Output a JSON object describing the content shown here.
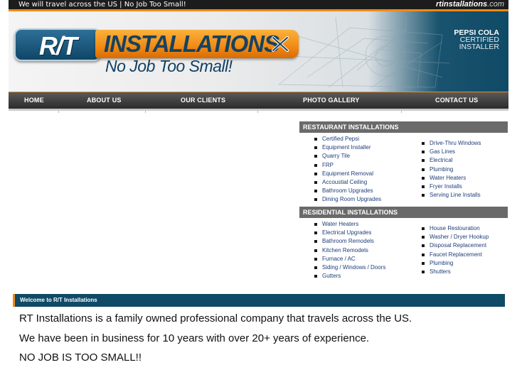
{
  "topbar": {
    "tagline": "We will travel across the US | No Job Too Small!",
    "domain_bold": "rtinstallations",
    "domain_suffix": ".com"
  },
  "header": {
    "logo_rt": "R/T",
    "logo_installations": "INSTALLATIONS",
    "slogan": "No Job Too Small!",
    "badge": [
      "PEPSI COLA",
      "CERTIFIED",
      "INSTALLER"
    ]
  },
  "nav": {
    "items": [
      "HOME",
      "ABOUT US",
      "OUR CLIENTS",
      "PHOTO GALLERY",
      "CONTACT US"
    ]
  },
  "restaurant": {
    "title": "RESTAURANT INSTALLATIONS",
    "col1": [
      "Certified Pepsi",
      "Equipment Installer",
      "Quarry Tile",
      "FRP",
      "Equipment Removal",
      "Accoustial Ceiling",
      "Bathroom Upgrades",
      "Dining Room Upgrades"
    ],
    "col2": [
      "Drive-Thru Windows",
      "Gas Lines",
      "Electrical",
      "Plumbing",
      "Water Heaters",
      "Fryer Installs",
      "Serving Line Installs"
    ]
  },
  "residential": {
    "title": "RESIDENTIAL INSTALLATIONS",
    "col1": [
      "Water Heaters",
      "Electrical Upgrades",
      "Bathroom Remodels",
      "Kitchen Remodels",
      "Furnace / AC",
      "Siding / Windows / Doors",
      "Gutters"
    ],
    "col2": [
      "House Restouration",
      "Washer / Dryer Hookup",
      "Disposal Replacement",
      "Faucet Replacement",
      "Plumbing",
      "Shutters"
    ]
  },
  "welcome": {
    "heading": "Welcome to R/T Installations",
    "lines": [
      "RT Installations is a family owned professional company that travels across the US.",
      "We have been in business for 10 years with over 20+ years of experience.",
      "NO JOB IS TOO SMALL!!"
    ]
  },
  "colors": {
    "accent_orange": "#f08a14",
    "brand_blue": "#0f4a66",
    "nav_dark": "#2b2b2b",
    "link_blue": "#1e3e78"
  }
}
